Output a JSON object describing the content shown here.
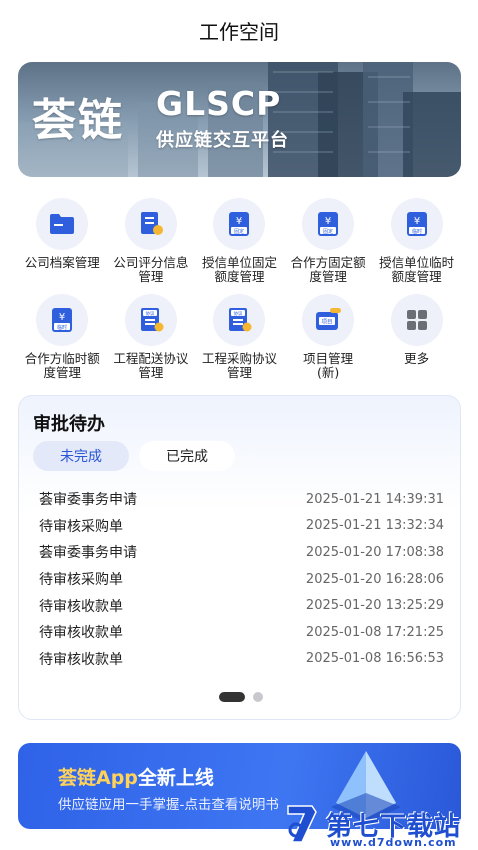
{
  "header": {
    "title": "工作空间"
  },
  "banner": {
    "brand_cn": "荟链",
    "brand_en": "GLSCP",
    "subtitle": "供应链交互平台"
  },
  "grid": {
    "items": [
      {
        "label": "公司档案管理",
        "icon": "folder-icon"
      },
      {
        "label": "公司评分信息\n管理",
        "icon": "rating-doc-icon"
      },
      {
        "label": "授信单位固定\n额度管理",
        "icon": "yuan-fixed-icon",
        "badge": "固定"
      },
      {
        "label": "合作方固定额\n度管理",
        "icon": "yuan-fixed-icon",
        "badge": "固定"
      },
      {
        "label": "授信单位临时\n额度管理",
        "icon": "yuan-temp-icon",
        "badge": "临时"
      },
      {
        "label": "合作方临时额\n度管理",
        "icon": "yuan-temp-icon",
        "badge": "临时"
      },
      {
        "label": "工程配送协议\n管理",
        "icon": "agreement-icon",
        "badge": "协议"
      },
      {
        "label": "工程采购协议\n管理",
        "icon": "agreement-icon",
        "badge": "协议"
      },
      {
        "label": "项目管理\n(新)",
        "icon": "project-icon",
        "badge": "项目"
      },
      {
        "label": "更多",
        "icon": "grid-more-icon"
      }
    ]
  },
  "approvals": {
    "title": "审批待办",
    "tab_pending": "未完成",
    "tab_done": "已完成",
    "rows": [
      {
        "title": "荟审委事务申请",
        "time": "2025-01-21 14:39:31"
      },
      {
        "title": "待审核采购单",
        "time": "2025-01-21 13:32:34"
      },
      {
        "title": "荟审委事务申请",
        "time": "2025-01-20 17:08:38"
      },
      {
        "title": "待审核采购单",
        "time": "2025-01-20 16:28:06"
      },
      {
        "title": "待审核收款单",
        "time": "2025-01-20 13:25:29"
      },
      {
        "title": "待审核收款单",
        "time": "2025-01-08 17:21:25"
      },
      {
        "title": "待审核收款单",
        "time": "2025-01-08 16:56:53"
      }
    ]
  },
  "promo": {
    "title_brand": "荟链App",
    "title_rest": "全新上线",
    "subtitle": "供应链应用一手掌握-点击查看说明书"
  },
  "watermark": {
    "text": "第七下载站",
    "url": "www.d7down.com"
  },
  "colors": {
    "accent": "#2a56d4",
    "icon_blue": "#2f5fdc",
    "promo_bg": "#3468ea"
  }
}
